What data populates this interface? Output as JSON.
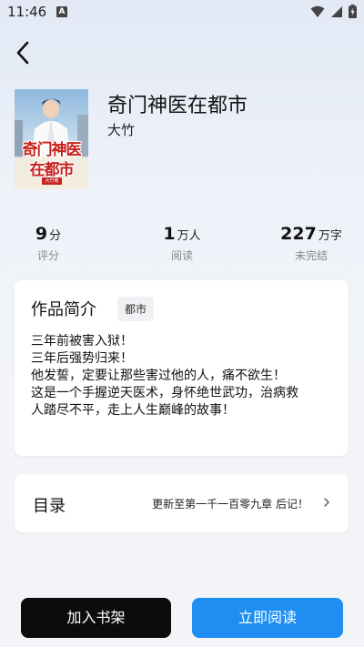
{
  "status_bar": {
    "time": "11:46",
    "notification_letter": "A"
  },
  "book": {
    "title": "奇门神医在都市",
    "author": "大竹",
    "cover_text": [
      "奇门神医",
      "在都市"
    ],
    "cover_badge": "大竹著"
  },
  "stats": [
    {
      "value": "9",
      "unit": "分",
      "label": "评分"
    },
    {
      "value": "1",
      "unit": "万人",
      "label": "阅读"
    },
    {
      "value": "227",
      "unit": "万字",
      "label": "未完结"
    }
  ],
  "intro": {
    "heading": "作品简介",
    "tag": "都市",
    "lines": [
      "三年前被害入狱！",
      "三年后强势归来！",
      "他发誓，定要让那些害过他的人，痛不欲生！",
      "这是一个手握逆天医术，身怀绝世武功，治病救",
      "人踏尽不平，走上人生巅峰的故事！"
    ]
  },
  "toc": {
    "title": "目录",
    "latest": "更新至第一千一百零九章 后记！"
  },
  "actions": {
    "add_shelf": "加入书架",
    "read_now": "立即阅读"
  },
  "colors": {
    "primary": "#1e8ef2",
    "dark_button": "#0c0c0c"
  }
}
